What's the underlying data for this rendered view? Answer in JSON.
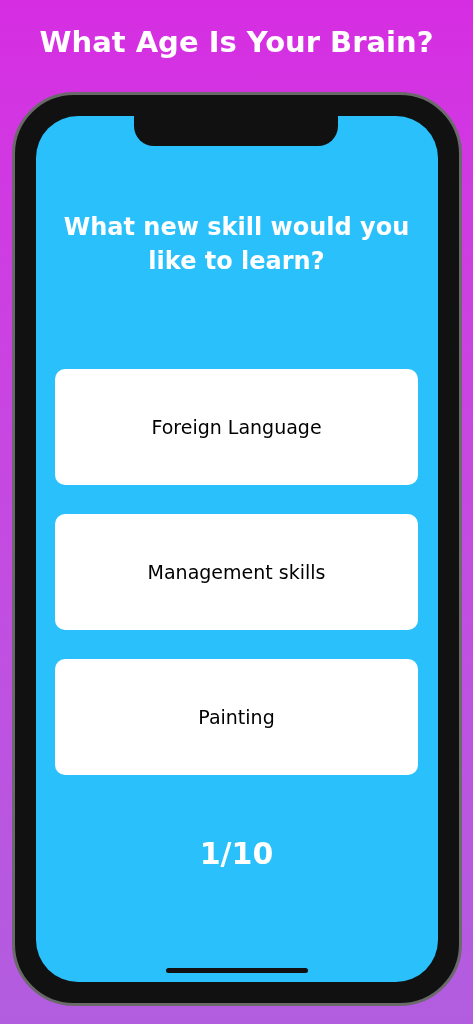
{
  "title": "What Age Is Your Brain?",
  "question": "What new skill would you like to learn?",
  "answers": [
    {
      "label": "Foreign Language"
    },
    {
      "label": "Management skills"
    },
    {
      "label": "Painting"
    }
  ],
  "progress": "1/10"
}
